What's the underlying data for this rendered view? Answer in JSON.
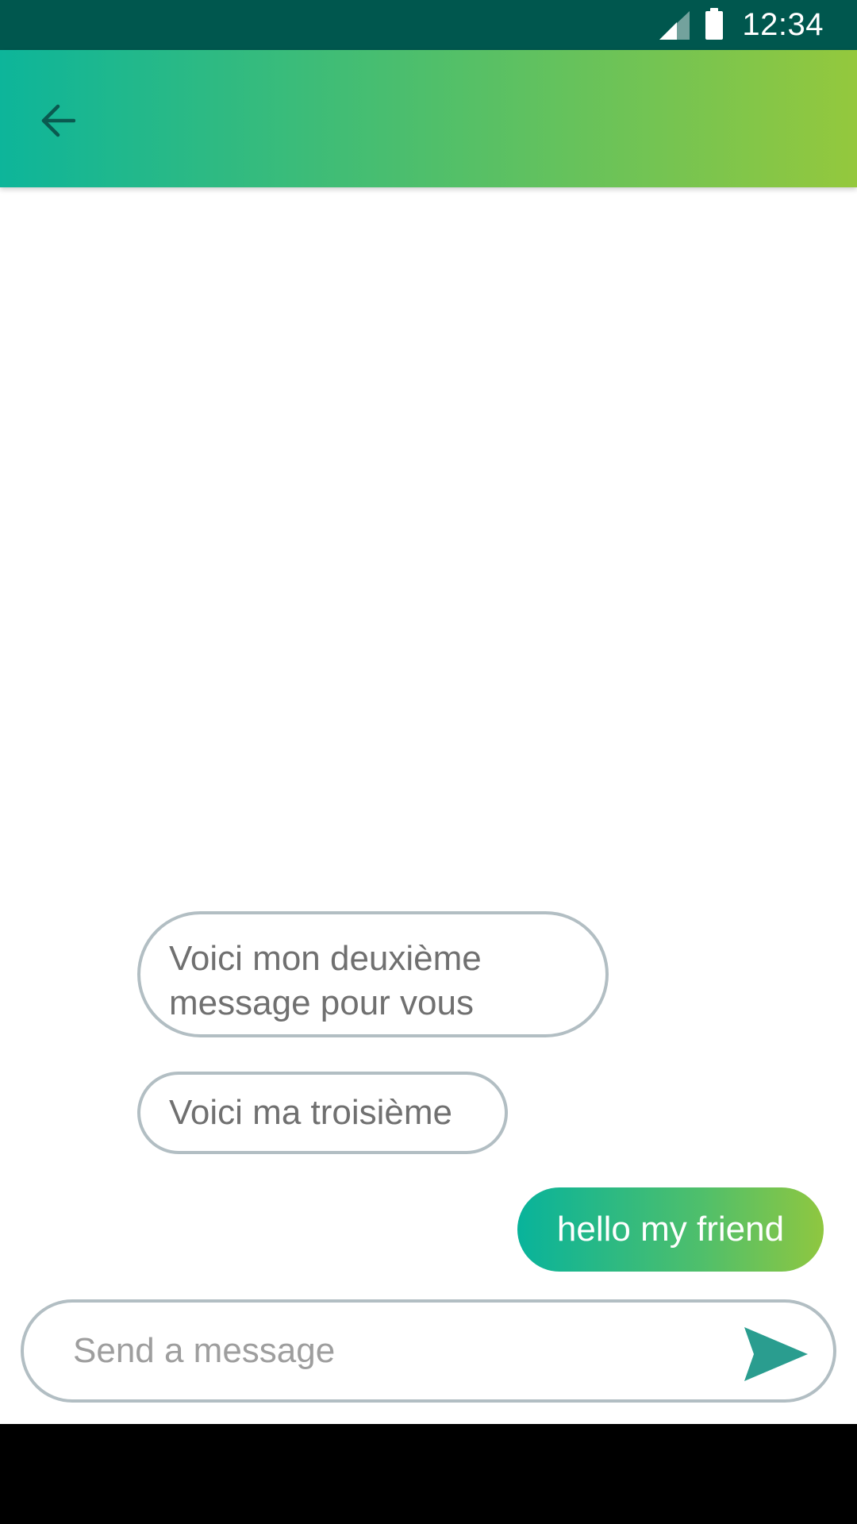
{
  "status_bar": {
    "time": "12:34",
    "icons": [
      "signal-icon",
      "battery-icon"
    ]
  },
  "app_bar": {
    "back_icon": "arrow-back-icon"
  },
  "messages": [
    {
      "direction": "incoming",
      "text": "Voici mon deuxième message pour vous"
    },
    {
      "direction": "incoming",
      "text": "Voici ma troisième"
    },
    {
      "direction": "outgoing",
      "text": "hello my friend"
    }
  ],
  "composer": {
    "placeholder": "Send a message",
    "value": "",
    "send_icon": "send-icon"
  },
  "colors": {
    "status_bar": "#00574e",
    "gradient_start": "#0db59a",
    "gradient_end": "#94c83d",
    "bubble_border": "#b2bec3",
    "incoming_text": "#707070",
    "send_icon": "#2a9d8f"
  }
}
